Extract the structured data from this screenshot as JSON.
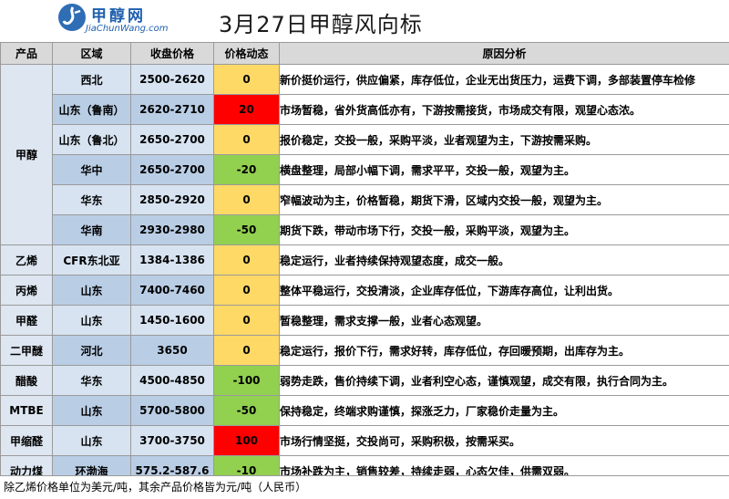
{
  "header": {
    "logo_name": "甲醇网",
    "logo_url": "JiaChunWang.com",
    "title": "3月27日甲醇风向标"
  },
  "columns": [
    "产品",
    "区域",
    "收盘价格",
    "价格动态",
    "原因分析"
  ],
  "colors": {
    "yellow": "#ffd966",
    "green": "#92d050",
    "red": "#ff0000",
    "header_bg": "#d9d9d9",
    "cell_blue_light": "#d7e3f1",
    "cell_blue_dark": "#b9cde5"
  },
  "products": {
    "methanol": "甲醇",
    "ethylene": "乙烯",
    "propylene": "丙烯",
    "formaldehyde": "甲醛",
    "dme": "二甲醚",
    "acetic_acid": "醋酸",
    "mtbe": "MTBE",
    "methylal": "甲缩醛",
    "thermal_coal": "动力煤"
  },
  "rows": [
    {
      "region": "西北",
      "price": "2500-2620",
      "change": "0",
      "color": "yellow",
      "reason": "新价挺价运行，供应偏紧，库存低位，企业无出货压力，运费下调，多部装置停车检修"
    },
    {
      "region": "山东（鲁南）",
      "price": "2620-2710",
      "change": "20",
      "color": "red",
      "reason": "市场暂稳，省外货高低亦有，下游按需接货，市场成交有限，观望心态浓。"
    },
    {
      "region": "山东（鲁北）",
      "price": "2650-2700",
      "change": "0",
      "color": "yellow",
      "reason": "报价稳定，交投一般，采购平淡，业者观望为主，下游按需采购。"
    },
    {
      "region": "华中",
      "price": "2650-2700",
      "change": "-20",
      "color": "green",
      "reason": "横盘整理，局部小幅下调，需求平平，交投一般，观望为主。"
    },
    {
      "region": "华东",
      "price": "2850-2920",
      "change": "0",
      "color": "yellow",
      "reason": "窄幅波动为主，价格暂稳，期货下滑，区域内交投一般，观望为主。"
    },
    {
      "region": "华南",
      "price": "2930-2980",
      "change": "-50",
      "color": "green",
      "reason": "期货下跌，带动市场下行，交投一般，采购平淡，观望为主。"
    },
    {
      "region": "CFR东北亚",
      "price": "1384-1386",
      "change": "0",
      "color": "yellow",
      "reason": "稳定运行，业者持续保持观望态度，成交一般。"
    },
    {
      "region": "山东",
      "price": "7400-7460",
      "change": "0",
      "color": "yellow",
      "reason": "整体平稳运行，交投清淡，企业库存低位，下游库存高位，让利出货。"
    },
    {
      "region": "山东",
      "price": "1450-1600",
      "change": "0",
      "color": "yellow",
      "reason": "暂稳整理，需求支撑一般，业者心态观望。"
    },
    {
      "region": "河北",
      "price": "3650",
      "change": "0",
      "color": "yellow",
      "reason": "稳定运行，报价下行，需求好转，库存低位，存回暖预期，出库存为主。"
    },
    {
      "region": "华东",
      "price": "4500-4850",
      "change": "-100",
      "color": "green",
      "reason": "弱势走跌，售价持续下调，业者利空心态，谨慎观望，成交有限，执行合同为主。"
    },
    {
      "region": "山东",
      "price": "5700-5800",
      "change": "-50",
      "color": "green",
      "reason": "保持稳定，终端求购谨慎，探涨乏力，厂家稳价走量为主。"
    },
    {
      "region": "山东",
      "price": "3700-3750",
      "change": "100",
      "color": "red",
      "reason": "市场行情坚挺，交投尚可，采购积极，按需采买。"
    },
    {
      "region": "环渤海",
      "price": "575.2-587.6",
      "change": "-10",
      "color": "green",
      "reason": "市场补跌为主，销售较差，持续走弱，心态欠佳，供需双弱。"
    }
  ],
  "footer": "除乙烯价格单位为美元/吨，其余产品价格皆为元/吨（人民币）"
}
